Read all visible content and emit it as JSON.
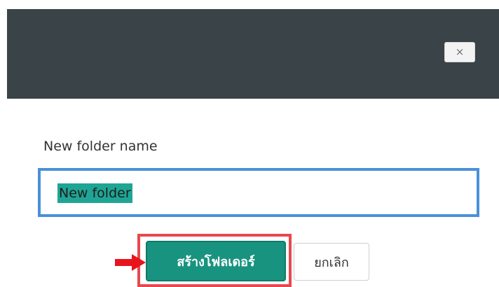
{
  "dialog": {
    "close_glyph": "×",
    "field_label": "New folder name",
    "folder_name_value": "New folder",
    "create_label": "สร้างโฟลเดอร์",
    "cancel_label": "ยกเลิก"
  },
  "colors": {
    "header_background": "#3a4347",
    "input_border": "#4a90d9",
    "text_selection": "#1fa595",
    "create_button": "#18937f",
    "highlight_frame": "#e8484d",
    "arrow": "#e8141c"
  },
  "icons": {
    "close": "close-icon",
    "pointer": "red-arrow-icon"
  }
}
